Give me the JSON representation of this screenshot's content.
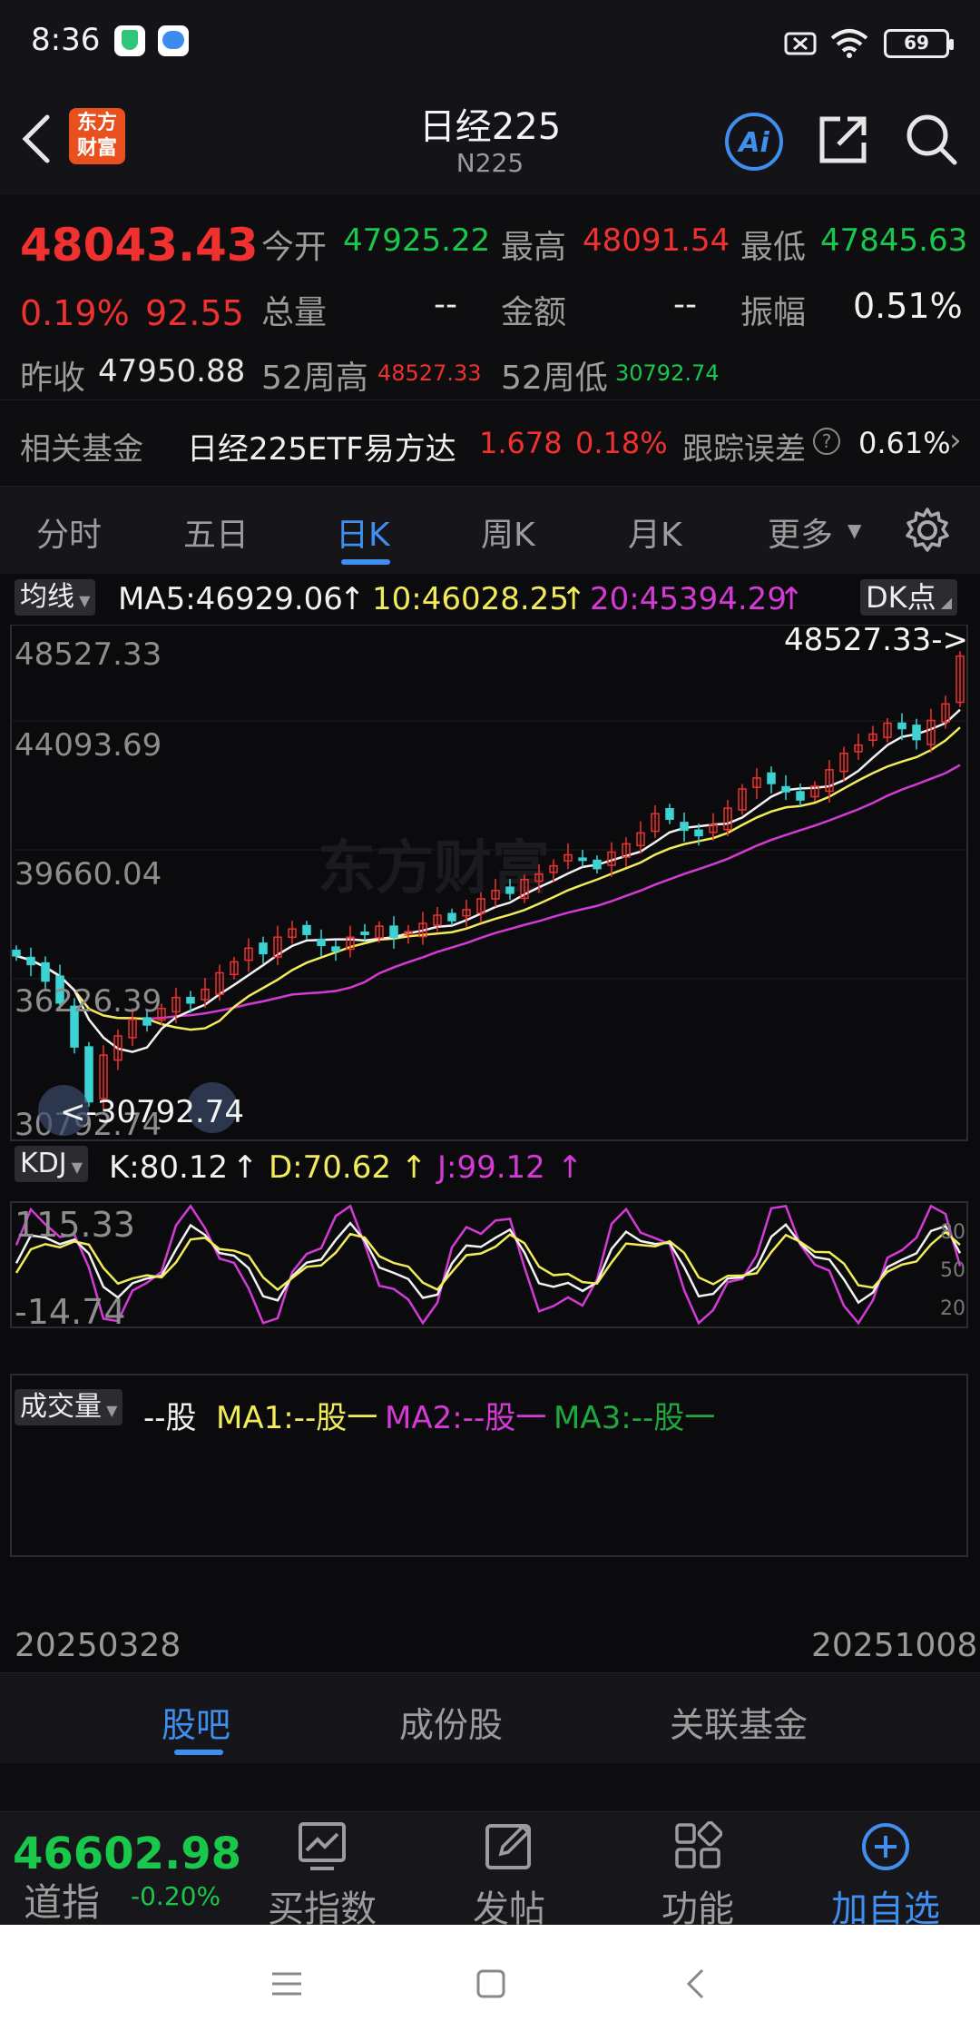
{
  "status_bar": {
    "time": "8:36",
    "battery": "69"
  },
  "header": {
    "logo_text": "东方\n财富",
    "title": "日经225",
    "subtitle": "N225"
  },
  "quote": {
    "price": "48043.43",
    "change_pct": "0.19%",
    "change": "92.55",
    "open_label": "今开",
    "open": "47925.22",
    "high_label": "最高",
    "high": "48091.54",
    "low_label": "最低",
    "low": "47845.63",
    "volume_label": "总量",
    "volume": "--",
    "amount_label": "金额",
    "amount": "--",
    "amplitude_label": "振幅",
    "amplitude": "0.51%",
    "prev_close_label": "昨收",
    "prev_close": "47950.88",
    "w52_high_label": "52周高",
    "w52_high": "48527.33",
    "w52_low_label": "52周低",
    "w52_low": "30792.74"
  },
  "fund": {
    "label": "相关基金",
    "name": "日经225ETF易方达",
    "price": "1.678",
    "pct": "0.18%",
    "tracking_label": "跟踪误差",
    "tracking": "0.61%"
  },
  "tabs": [
    "分时",
    "五日",
    "日K",
    "周K",
    "月K",
    "更多"
  ],
  "ma_legend": {
    "selector": "均线",
    "ma5": "MA5:46929.06",
    "ma10": "10:46028.25",
    "ma20": "20:45394.29",
    "dk_button": "DK点",
    "arrow": "↑"
  },
  "price_axis": [
    "48527.33",
    "44093.69",
    "39660.04",
    "36226.39",
    "30792.74"
  ],
  "max_marker": "48527.33->",
  "min_marker": "<-30792.74",
  "watermark": "东方财富",
  "kdj": {
    "selector": "KDJ",
    "k": "K:80.12",
    "d": "D:70.62",
    "j": "J:99.12",
    "top": "115.33",
    "bottom": "-14.74",
    "levels": [
      "80",
      "50",
      "20"
    ]
  },
  "volume_panel": {
    "selector": "成交量",
    "unit": "--股",
    "ma1": "MA1:--股一",
    "ma2": "MA2:--股一",
    "ma3": "MA3:--股一"
  },
  "dates": {
    "start": "20250328",
    "end": "20251008"
  },
  "sub_tabs": [
    "股吧",
    "成份股",
    "关联基金"
  ],
  "nav": {
    "index_value": "46602.98",
    "index_name": "道指",
    "index_pct": "-0.20%",
    "items": [
      "买指数",
      "发帖",
      "功能",
      "加自选"
    ]
  },
  "colors": {
    "up": "#f0312f",
    "down": "#19c84b",
    "accent": "#3f8ff0",
    "ma10": "#f2ec5a",
    "ma20": "#d63ad6"
  },
  "chart_data": {
    "type": "candlestick",
    "title": "日经225",
    "ylim": [
      30792.74,
      48527.33
    ],
    "close_series": [
      37120,
      36800,
      36200,
      35400,
      33800,
      31800,
      33500,
      34200,
      34800,
      34600,
      35200,
      35600,
      35400,
      35900,
      36500,
      36900,
      37400,
      37200,
      37800,
      38100,
      37900,
      37500,
      37300,
      37800,
      37900,
      38200,
      37800,
      38000,
      38300,
      38600,
      38400,
      38800,
      39200,
      39500,
      39400,
      39900,
      40100,
      40400,
      40800,
      40600,
      40300,
      40900,
      41200,
      41600,
      42300,
      42100,
      41700,
      41500,
      41900,
      42500,
      43200,
      43600,
      43400,
      43100,
      42800,
      43300,
      43900,
      44500,
      44800,
      45200,
      45600,
      45400,
      45000,
      45700,
      46300,
      48043
    ]
  }
}
